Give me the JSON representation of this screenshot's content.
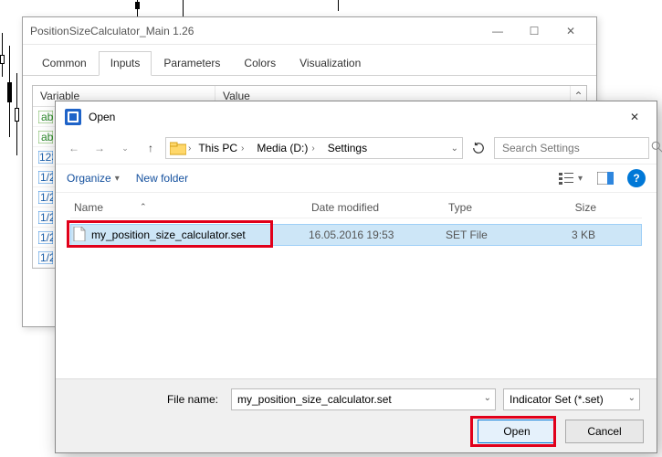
{
  "parent": {
    "title": "PositionSizeCalculator_Main 1.26",
    "tabs": [
      "Common",
      "Inputs",
      "Parameters",
      "Colors",
      "Visualization"
    ],
    "active_tab": 1,
    "col_variable": "Variable",
    "col_value": "Value"
  },
  "open_dialog": {
    "title": "Open",
    "breadcrumb": [
      "This PC",
      "Media (D:)",
      "Settings"
    ],
    "search_placeholder": "Search Settings",
    "toolbar": {
      "organize": "Organize",
      "newfolder": "New folder"
    },
    "columns": {
      "name": "Name",
      "date": "Date modified",
      "type": "Type",
      "size": "Size"
    },
    "file": {
      "name": "my_position_size_calculator.set",
      "date": "16.05.2016 19:53",
      "type": "SET File",
      "size": "3 KB"
    },
    "filename_label": "File name:",
    "filename_value": "my_position_size_calculator.set",
    "filter": "Indicator Set (*.set)",
    "open_btn": "Open",
    "cancel_btn": "Cancel"
  }
}
